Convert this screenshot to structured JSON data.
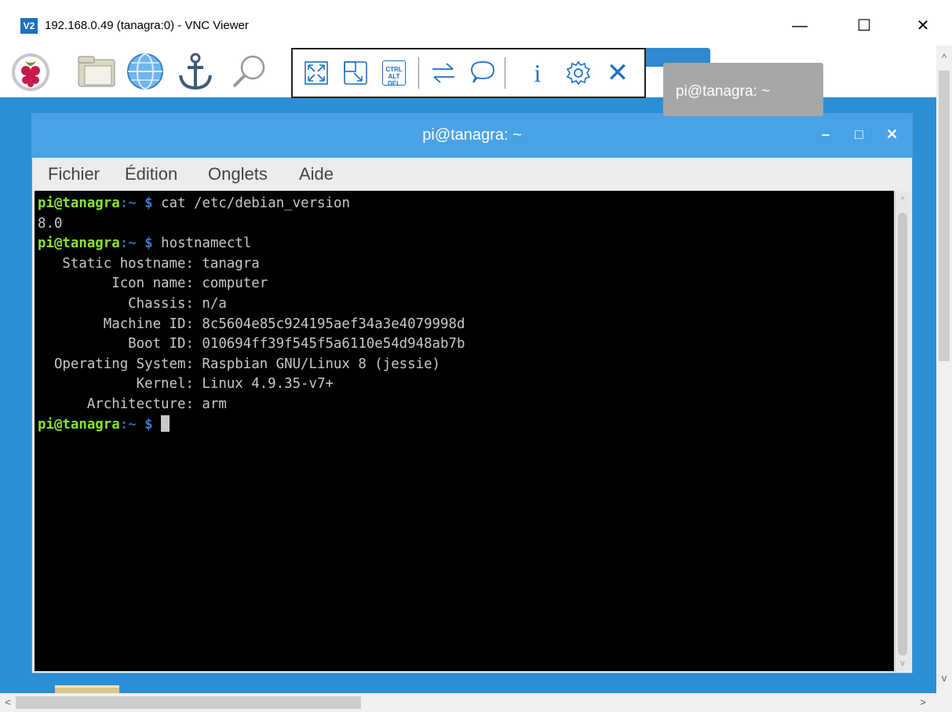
{
  "window": {
    "app_icon_label": "V2",
    "title": "192.168.0.49 (tanagra:0) - VNC Viewer",
    "minimize_glyph": "—",
    "maximize_glyph": "☐",
    "close_glyph": "✕"
  },
  "panel": {
    "icons": [
      "raspberry-menu-icon",
      "file-manager-icon",
      "web-browser-icon",
      "anchor-icon",
      "search-icon"
    ]
  },
  "vnc_toolbar": {
    "buttons": [
      "fullscreen-icon",
      "scale-icon",
      "ctrl-alt-del-icon",
      "transfer-icon",
      "chat-icon",
      "info-icon",
      "settings-icon",
      "close-toolbar-icon"
    ],
    "cad_label": "CTRL ALT DEL",
    "info_glyph": "i",
    "close_glyph": "✕",
    "accent": "#1f6fc0"
  },
  "tooltip": {
    "text": "pi@tanagra: ~"
  },
  "terminal": {
    "title": "pi@tanagra: ~",
    "min_glyph": "–",
    "max_glyph": "□",
    "close_glyph": "✕",
    "menu": [
      "Fichier",
      "Édition",
      "Onglets",
      "Aide"
    ],
    "prompt_user": "pi@tanagra",
    "prompt_sep": ":",
    "prompt_dir": "~",
    "prompt_sym": "$",
    "lines": [
      {
        "type": "prompt",
        "cmd": "cat /etc/debian_version"
      },
      {
        "type": "out",
        "text": "8.0"
      },
      {
        "type": "prompt",
        "cmd": "hostnamectl"
      },
      {
        "type": "out",
        "text": "   Static hostname: tanagra"
      },
      {
        "type": "out",
        "text": "         Icon name: computer"
      },
      {
        "type": "out",
        "text": "           Chassis: n/a"
      },
      {
        "type": "out",
        "text": "        Machine ID: 8c5604e85c924195aef34a3e4079998d"
      },
      {
        "type": "out",
        "text": "           Boot ID: 010694ff39f545f5a6110e54d948ab7b"
      },
      {
        "type": "out",
        "text": "  Operating System: Raspbian GNU/Linux 8 (jessie)"
      },
      {
        "type": "out",
        "text": "            Kernel: Linux 4.9.35-v7+"
      },
      {
        "type": "out",
        "text": "      Architecture: arm"
      },
      {
        "type": "prompt",
        "cmd": "",
        "cursor": true
      }
    ]
  },
  "scrollbars": {
    "up_glyph": "^",
    "down_glyph": "v",
    "left_glyph": "<",
    "right_glyph": ">"
  },
  "colors": {
    "desktop": "#2b8fd6",
    "terminal_title": "#4aa2e6",
    "prompt_user": "#8ae234",
    "prompt_dir": "#3465a4"
  }
}
